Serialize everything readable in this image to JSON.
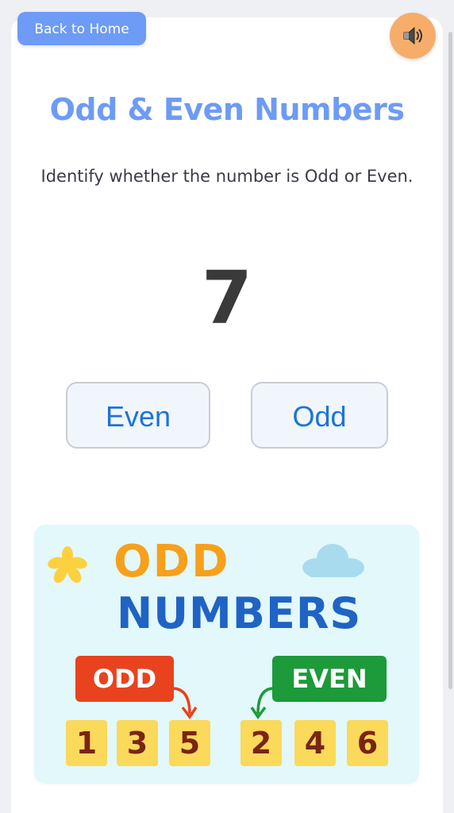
{
  "header": {
    "back_label": "Back to Home",
    "sound_icon": "speaker-icon"
  },
  "quiz": {
    "title": "Odd & Even Numbers",
    "instruction": "Identify whether the number is Odd or Even.",
    "number": "7",
    "options": [
      "Even",
      "Odd"
    ]
  },
  "illustration": {
    "line1": "ODD",
    "line2": "NUMBERS",
    "odd_tag": "ODD",
    "even_tag": "EVEN",
    "odd_numbers": [
      "1",
      "3",
      "5"
    ],
    "even_numbers": [
      "2",
      "4",
      "6"
    ]
  },
  "colors": {
    "accent": "#6d9bf5",
    "sound_button": "#f6ad6a",
    "button_text": "#1b74d9",
    "odd_tag": "#e8431e",
    "even_tag": "#1d9a3a",
    "number_box": "#fbd95a"
  }
}
